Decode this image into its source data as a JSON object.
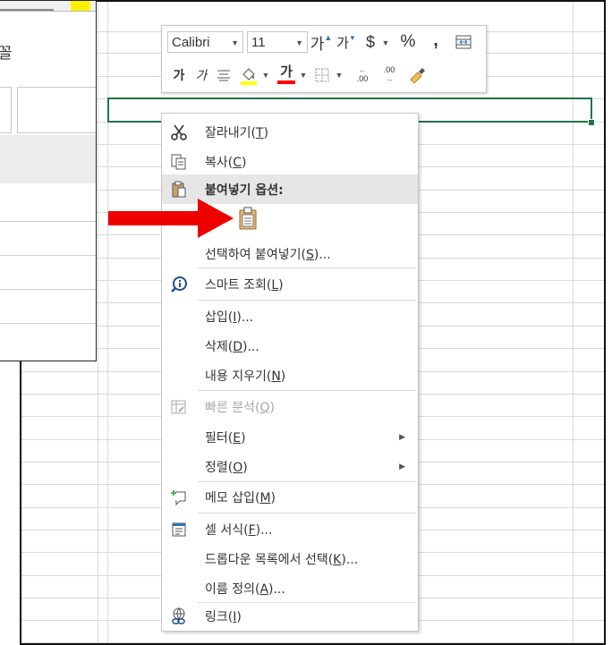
{
  "mini_toolbar": {
    "font_name": "Calibri",
    "font_size": "11",
    "increase_font_label": "가",
    "decrease_font_label": "가",
    "currency_label": "$",
    "percent_label": "%",
    "comma_label": ",",
    "bold_label": "가",
    "italic_label": "가",
    "font_color_label": "가",
    "increase_decimal_label": ".00",
    "decrease_decimal_label": ".00",
    "colors": {
      "highlight": "#ffff00",
      "font": "#ff0000"
    }
  },
  "dialog": {
    "title_fragment": "꼴"
  },
  "context_menu": {
    "items": [
      {
        "icon": "scissors-icon",
        "label": "잘라내기(",
        "key": "T",
        "tail": ")"
      },
      {
        "icon": "copy-icon",
        "label": "복사(",
        "key": "C",
        "tail": ")"
      },
      {
        "icon": "paste-icon",
        "label": "붙여넣기 옵션:",
        "key": "",
        "tail": ""
      },
      {
        "icon": "",
        "label": "선택하여 붙여넣기(",
        "key": "S",
        "tail": ")..."
      },
      {
        "icon": "smart-lookup-icon",
        "label": "스마트 조회(",
        "key": "L",
        "tail": ")"
      },
      {
        "icon": "",
        "label": "삽입(",
        "key": "I",
        "tail": ")..."
      },
      {
        "icon": "",
        "label": "삭제(",
        "key": "D",
        "tail": ")..."
      },
      {
        "icon": "",
        "label": "내용 지우기(",
        "key": "N",
        "tail": ")"
      },
      {
        "icon": "quick-analysis-icon",
        "label": "빠른 분석(",
        "key": "Q",
        "tail": ")"
      },
      {
        "icon": "",
        "label": "필터(",
        "key": "E",
        "tail": ")"
      },
      {
        "icon": "",
        "label": "정렬(",
        "key": "O",
        "tail": ")"
      },
      {
        "icon": "new-comment-icon",
        "label": "메모 삽입(",
        "key": "M",
        "tail": ")"
      },
      {
        "icon": "format-cells-icon",
        "label": "셀 서식(",
        "key": "F",
        "tail": ")..."
      },
      {
        "icon": "",
        "label": "드롭다운 목록에서 선택(",
        "key": "K",
        "tail": ")..."
      },
      {
        "icon": "",
        "label": "이름 정의(",
        "key": "A",
        "tail": ")..."
      },
      {
        "icon": "link-icon",
        "label": "링크(",
        "key": "I",
        "tail": ")"
      }
    ]
  },
  "annotation": {
    "arrow_color": "#ee0000"
  }
}
